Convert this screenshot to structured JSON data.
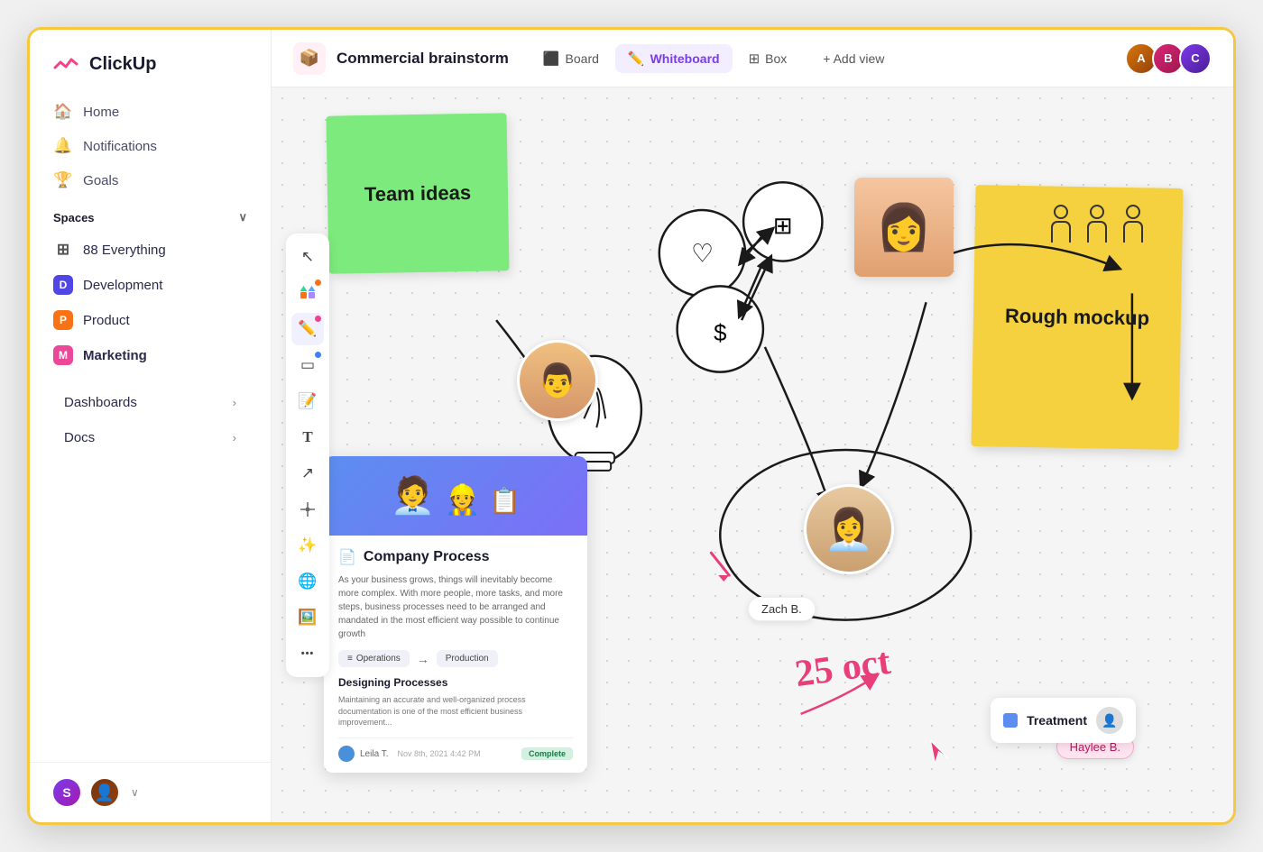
{
  "app": {
    "name": "ClickUp"
  },
  "sidebar": {
    "nav_items": [
      {
        "id": "home",
        "label": "Home",
        "icon": "🏠"
      },
      {
        "id": "notifications",
        "label": "Notifications",
        "icon": "🔔"
      },
      {
        "id": "goals",
        "label": "Goals",
        "icon": "🏆"
      }
    ],
    "spaces_label": "Spaces",
    "spaces": [
      {
        "id": "everything",
        "label": "88 Everything",
        "color": "",
        "letter": "⊞"
      },
      {
        "id": "development",
        "label": "Development",
        "color": "#4f46e5",
        "letter": "D"
      },
      {
        "id": "product",
        "label": "Product",
        "color": "#f97316",
        "letter": "P"
      },
      {
        "id": "marketing",
        "label": "Marketing",
        "color": "#ec4899",
        "letter": "M",
        "bold": true
      }
    ],
    "sections": [
      {
        "id": "dashboards",
        "label": "Dashboards"
      },
      {
        "id": "docs",
        "label": "Docs"
      }
    ],
    "bottom_avatars": [
      "S",
      "👤"
    ]
  },
  "toolbar": {
    "icon": "📦",
    "title": "Commercial brainstorm",
    "views": [
      {
        "id": "whiteboard",
        "label": "Whiteboard",
        "icon": "✏️",
        "active": true
      },
      {
        "id": "board",
        "label": "Board",
        "icon": "⬛"
      },
      {
        "id": "box",
        "label": "Box",
        "icon": "⊞"
      }
    ],
    "add_view_label": "+ Add view",
    "avatars": [
      {
        "initials": "A",
        "class": "ta1"
      },
      {
        "initials": "B",
        "class": "ta2"
      },
      {
        "initials": "C",
        "class": "ta3"
      }
    ]
  },
  "tools": [
    {
      "id": "cursor",
      "icon": "↖",
      "dot": null
    },
    {
      "id": "shapes",
      "icon": "🎨",
      "dot": "#f97316"
    },
    {
      "id": "pencil",
      "icon": "✏️",
      "dot": "#f43f8e"
    },
    {
      "id": "rectangle",
      "icon": "▭",
      "dot": "#3b82f6"
    },
    {
      "id": "sticky",
      "icon": "📝",
      "dot": null
    },
    {
      "id": "text",
      "icon": "T",
      "dot": null
    },
    {
      "id": "connector",
      "icon": "↗",
      "dot": null
    },
    {
      "id": "network",
      "icon": "⑂",
      "dot": null
    },
    {
      "id": "sparkle",
      "icon": "✨",
      "dot": null
    },
    {
      "id": "globe",
      "icon": "🌐",
      "dot": null
    },
    {
      "id": "image",
      "icon": "🖼️",
      "dot": null
    },
    {
      "id": "more",
      "icon": "•••",
      "dot": null
    }
  ],
  "whiteboard": {
    "sticky_team": "Team ideas",
    "sticky_mockup": "Rough mockup",
    "doc_card": {
      "title": "Company Process",
      "text": "As your business grows, things will inevitably become more complex. With more people, more tasks, and more steps, business processes need to be arranged and mandated in the most efficient way possible to continue growth",
      "flow_from": "Operations",
      "flow_to": "Production",
      "sub_title": "Designing Processes",
      "sub_text": "Maintaining an accurate and well-organized process documentation is one of the most efficient business improvement...",
      "author": "Leila T.",
      "date": "Nov 8th, 2021 4:42 PM",
      "status": "Complete"
    },
    "person_labels": [
      {
        "id": "zach",
        "name": "Zach B.",
        "pink": false
      },
      {
        "id": "haylee",
        "name": "Haylee B.",
        "pink": true
      }
    ],
    "treatment_card": {
      "label": "Treatment"
    },
    "date_label": "25 oct"
  }
}
